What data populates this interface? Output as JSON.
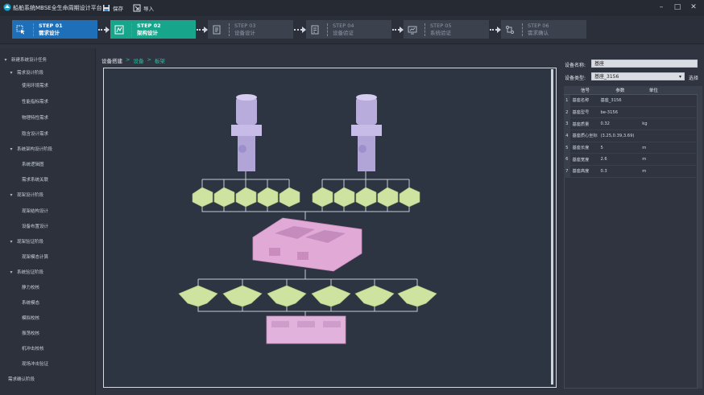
{
  "app": {
    "title": "船舶系统MBSE全生命周期设计平台"
  },
  "toolbar": {
    "save_label": "保存",
    "import_label": "导入"
  },
  "window": {
    "minimize": "–",
    "maximize": "□",
    "close": "✕"
  },
  "steps": [
    {
      "num": "STEP 01",
      "name": "需求设计",
      "icon": "cursor-select-icon",
      "state": "done"
    },
    {
      "num": "STEP 02",
      "name": "架构设计",
      "icon": "architecture-icon",
      "state": "active"
    },
    {
      "num": "STEP 03",
      "name": "设备设计",
      "icon": "layers-icon",
      "state": "pending"
    },
    {
      "num": "STEP 04",
      "name": "设备验证",
      "icon": "checklist-icon",
      "state": "pending"
    },
    {
      "num": "STEP 05",
      "name": "系统验证",
      "icon": "monitor-chart-icon",
      "state": "pending"
    },
    {
      "num": "STEP 06",
      "name": "需求确认",
      "icon": "flow-confirm-icon",
      "state": "pending"
    }
  ],
  "sidebar": {
    "items": [
      {
        "label": "新建系统设计任务",
        "level": 0
      },
      {
        "label": "需求设计阶段",
        "level": 1
      },
      {
        "label": "使用环境需求",
        "level": 2
      },
      {
        "label": "性能指标需求",
        "level": 2
      },
      {
        "label": "物理特性需求",
        "level": 2
      },
      {
        "label": "隐含设计需求",
        "level": 2
      },
      {
        "label": "系统架构设计阶段",
        "level": 1
      },
      {
        "label": "系统逻辑图",
        "level": 2
      },
      {
        "label": "需求系统关联",
        "level": 2
      },
      {
        "label": "现架设计阶段",
        "level": 1
      },
      {
        "label": "现架结构设计",
        "level": 2
      },
      {
        "label": "设备布置设计",
        "level": 2
      },
      {
        "label": "现架验证阶段",
        "level": 1
      },
      {
        "label": "现架模态计算",
        "level": 2
      },
      {
        "label": "系统验证阶段",
        "level": 1
      },
      {
        "label": "静力校核",
        "level": 2
      },
      {
        "label": "系统模态",
        "level": 2
      },
      {
        "label": "模拟校核",
        "level": 2
      },
      {
        "label": "振荡校核",
        "level": 2
      },
      {
        "label": "机冲击校核",
        "level": 2
      },
      {
        "label": "现场冲击验证",
        "level": 2
      },
      {
        "label": "需求确认阶段",
        "level": 1
      }
    ]
  },
  "breadcrumb": [
    "设备搭建",
    "设备",
    "板架"
  ],
  "right_panel": {
    "name_label": "设备名称:",
    "name_value": "基座",
    "type_label": "设备类型:",
    "type_value": "基座_3156",
    "select_button": "选择",
    "table": {
      "headers": [
        "信号",
        "参数",
        "单位"
      ],
      "rows": [
        {
          "idx": "1",
          "name": "基座名称",
          "value": "基座_3156",
          "unit": ""
        },
        {
          "idx": "2",
          "name": "基座型号",
          "value": "be-3156",
          "unit": ""
        },
        {
          "idx": "3",
          "name": "基座质量",
          "value": "0.32",
          "unit": "kg"
        },
        {
          "idx": "4",
          "name": "基座质心坐标",
          "value": "(3.25,0.39,3.69)",
          "unit": ""
        },
        {
          "idx": "5",
          "name": "基座长度",
          "value": "5",
          "unit": "m"
        },
        {
          "idx": "6",
          "name": "基座宽度",
          "value": "2.6",
          "unit": "m"
        },
        {
          "idx": "7",
          "name": "基座高度",
          "value": "0.3",
          "unit": "m"
        }
      ]
    }
  },
  "colors": {
    "accent_blue": "#1f6fb8",
    "accent_teal": "#17a68c",
    "model_violet": "#c2b7e6",
    "model_green": "#cfe3a1",
    "model_pink": "#e1a9d6",
    "background": "#2f3440"
  }
}
